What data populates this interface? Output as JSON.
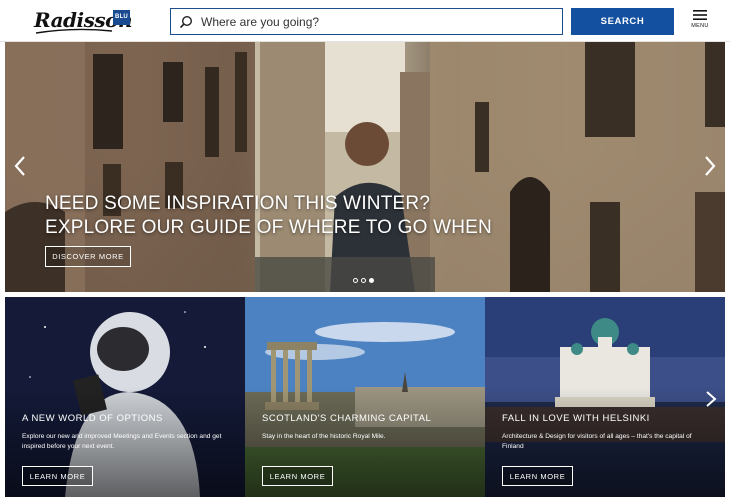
{
  "header": {
    "logo_text": "Radisson",
    "logo_badge": "BLU",
    "search_placeholder": "Where are you going?",
    "search_button": "SEARCH",
    "menu_label": "MENU"
  },
  "hero": {
    "title_line1": "NEED SOME INSPIRATION THIS WINTER?",
    "title_line2": "EXPLORE OUR GUIDE OF WHERE TO GO WHEN",
    "cta": "DISCOVER MORE",
    "slides": 3,
    "active_slide": 3,
    "icons": {
      "prev": "chevron-left-icon",
      "next": "chevron-right-icon"
    }
  },
  "cards": [
    {
      "title": "A NEW WORLD OF OPTIONS",
      "description": "Explore our new and improved Meetings and Events section and get inspired before your next event.",
      "cta": "LEARN MORE"
    },
    {
      "title": "SCOTLAND'S CHARMING CAPITAL",
      "description": "Stay in the heart of the historic Royal Mile.",
      "cta": "LEARN MORE"
    },
    {
      "title": "FALL IN LOVE WITH HELSINKI",
      "description": "Architecture & Design for visitors of all ages – that's the capital of Finland",
      "cta": "LEARN MORE"
    }
  ],
  "colors": {
    "brand_blue": "#1450a0",
    "search_border": "#1d4d8e",
    "text_white": "#ffffff"
  }
}
